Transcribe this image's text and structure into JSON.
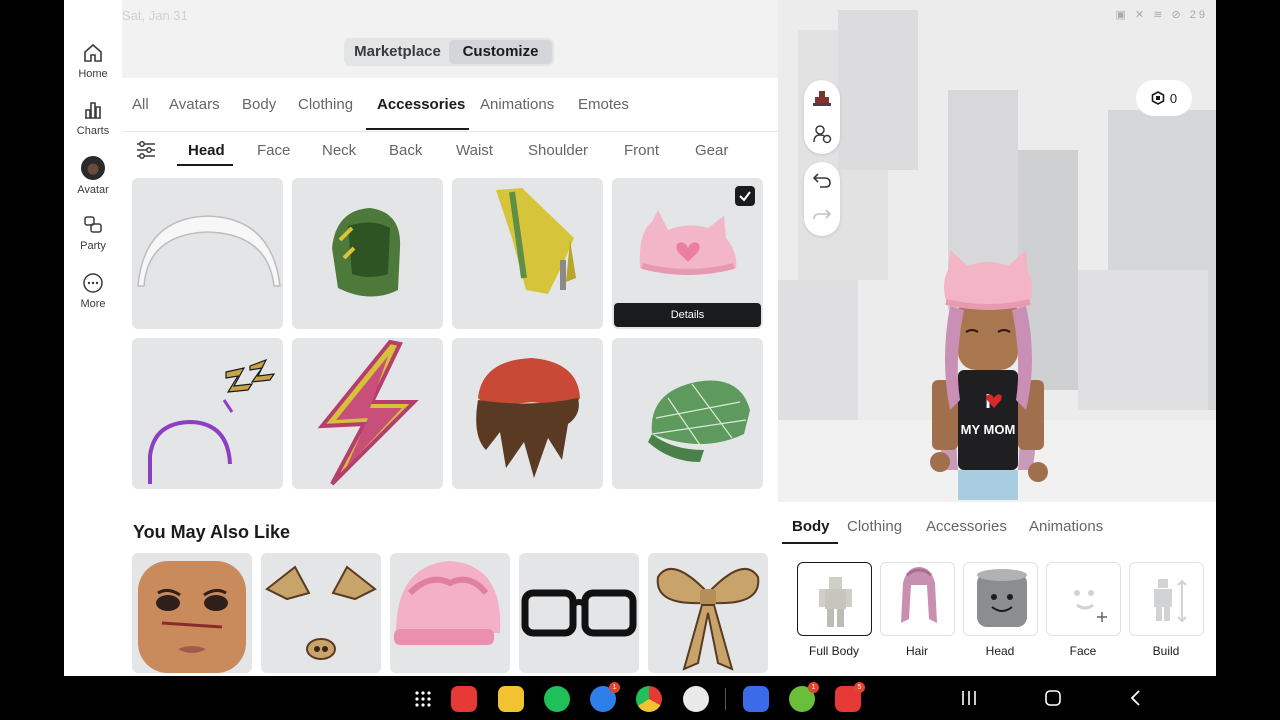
{
  "status": {
    "date": "Sat, Jan 31",
    "battery": "29"
  },
  "rail": [
    {
      "label": "Home",
      "icon": "home-icon"
    },
    {
      "label": "Charts",
      "icon": "charts-icon"
    },
    {
      "label": "Avatar",
      "icon": "avatar-icon"
    },
    {
      "label": "Party",
      "icon": "party-icon"
    },
    {
      "label": "More",
      "icon": "more-icon"
    }
  ],
  "topbar": {
    "marketplace": "Marketplace",
    "customize": "Customize",
    "active": "Customize"
  },
  "category_tabs": [
    "All",
    "Avatars",
    "Body",
    "Clothing",
    "Accessories",
    "Animations",
    "Emotes"
  ],
  "category_active": "Accessories",
  "sub_tabs": [
    "Head",
    "Face",
    "Neck",
    "Back",
    "Waist",
    "Shoulder",
    "Front",
    "Gear"
  ],
  "sub_active": "Head",
  "grid_items": [
    {
      "name": "white-headband"
    },
    {
      "name": "green-hood"
    },
    {
      "name": "yellow-wing-helmet"
    },
    {
      "name": "pink-cat-beanie",
      "selected": true,
      "details_label": "Details"
    },
    {
      "name": "zzz-headband"
    },
    {
      "name": "lightning-bolt"
    },
    {
      "name": "brown-hair-red-beanie"
    },
    {
      "name": "green-plaid-cap"
    }
  ],
  "ymal": {
    "title": "You May Also Like",
    "items": [
      "face-makeup",
      "leopard-ears-nose",
      "pink-beanie",
      "black-glasses",
      "leopard-bow"
    ]
  },
  "preview": {
    "robux": "0",
    "shirt_text": [
      "I",
      "MY MOM"
    ]
  },
  "body_tabs": [
    "Body",
    "Clothing",
    "Accessories",
    "Animations"
  ],
  "body_active": "Body",
  "body_items": [
    {
      "label": "Full Body"
    },
    {
      "label": "Hair"
    },
    {
      "label": "Head"
    },
    {
      "label": "Face"
    },
    {
      "label": "Build"
    }
  ],
  "colors": {
    "accent": "#1a1b1d",
    "tile_bg": "#e4e5e7",
    "badge": "#e5432d"
  },
  "taskbar": {
    "badges": {
      "messages": "1",
      "ring": "1",
      "youtube": "5"
    }
  }
}
